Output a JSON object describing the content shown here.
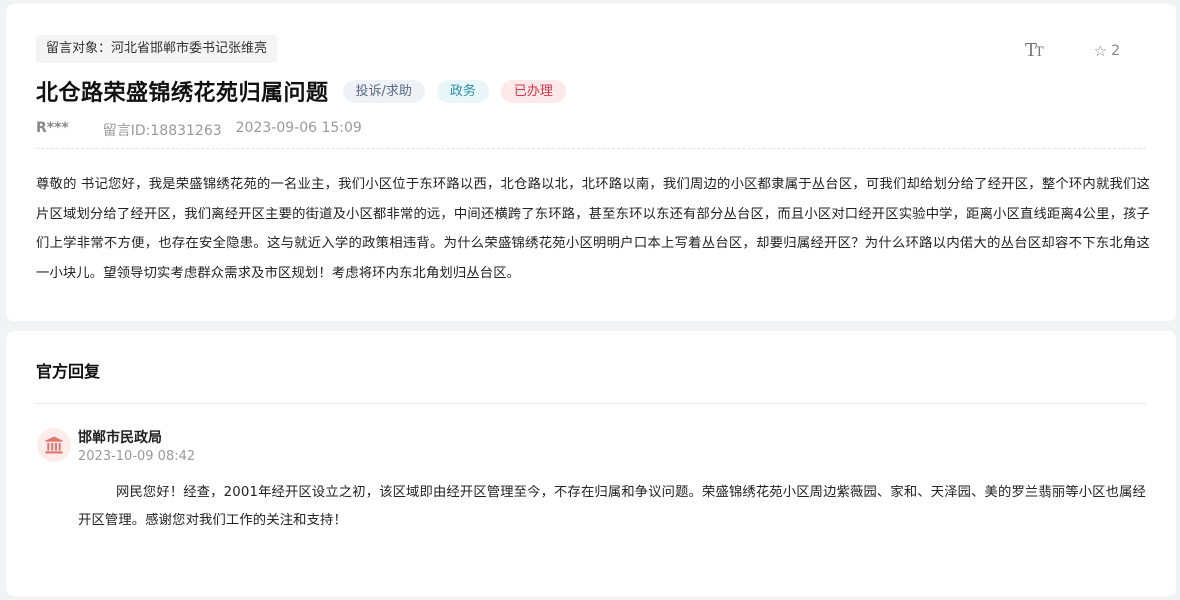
{
  "message": {
    "target": "留言对象：河北省邯郸市委书记张维亮",
    "font_size_icon": "font-size-icon",
    "favorite_icon": "star-outline-icon",
    "favorite_count": "2",
    "title": "北仓路荣盛锦绣花苑归属问题",
    "tags": [
      "投诉/求助",
      "政务",
      "已办理"
    ],
    "author": "R***",
    "message_id": "留言ID:18831263",
    "datetime": "2023-09-06 15:09",
    "content": "尊敬的 书记您好，我是荣盛锦绣花苑的一名业主，我们小区位于东环路以西，北仓路以北，北环路以南，我们周边的小区都隶属于丛台区，可我们却给划分给了经开区，整个环内就我们这片区域划分给了经开区，我们离经开区主要的街道及小区都非常的远，中间还横跨了东环路，甚至东环以东还有部分丛台区，而且小区对口经开区实验中学，距离小区直线距离4公里，孩子们上学非常不方便，也存在安全隐患。这与就近入学的政策相违背。为什么荣盛锦绣花苑小区明明户口本上写着丛台区，却要归属经开区？为什么环路以内偌大的丛台区却容不下东北角这一小块儿。望领导切实考虑群众需求及市区规划！考虑将环内东北角划归丛台区。"
  },
  "reply": {
    "heading": "官方回复",
    "department": "邯郸市民政局",
    "department_icon": "government-building-icon",
    "datetime": "2023-10-09 08:42",
    "content": "网民您好！经查，2001年经开区设立之初，该区域即由经开区管理至今，不存在归属和争议问题。荣盛锦绣花苑小区周边紫薇园、家和、天泽园、美的罗兰翡丽等小区也属经开区管理。感谢您对我们工作的关注和支持！"
  },
  "colors": {
    "page_bg": "#f2f3f5",
    "tag_gray": "#5a6b86",
    "tag_cyan": "#2a8fa8",
    "tag_red": "#d6354b",
    "dept_icon": "#e0786f"
  }
}
